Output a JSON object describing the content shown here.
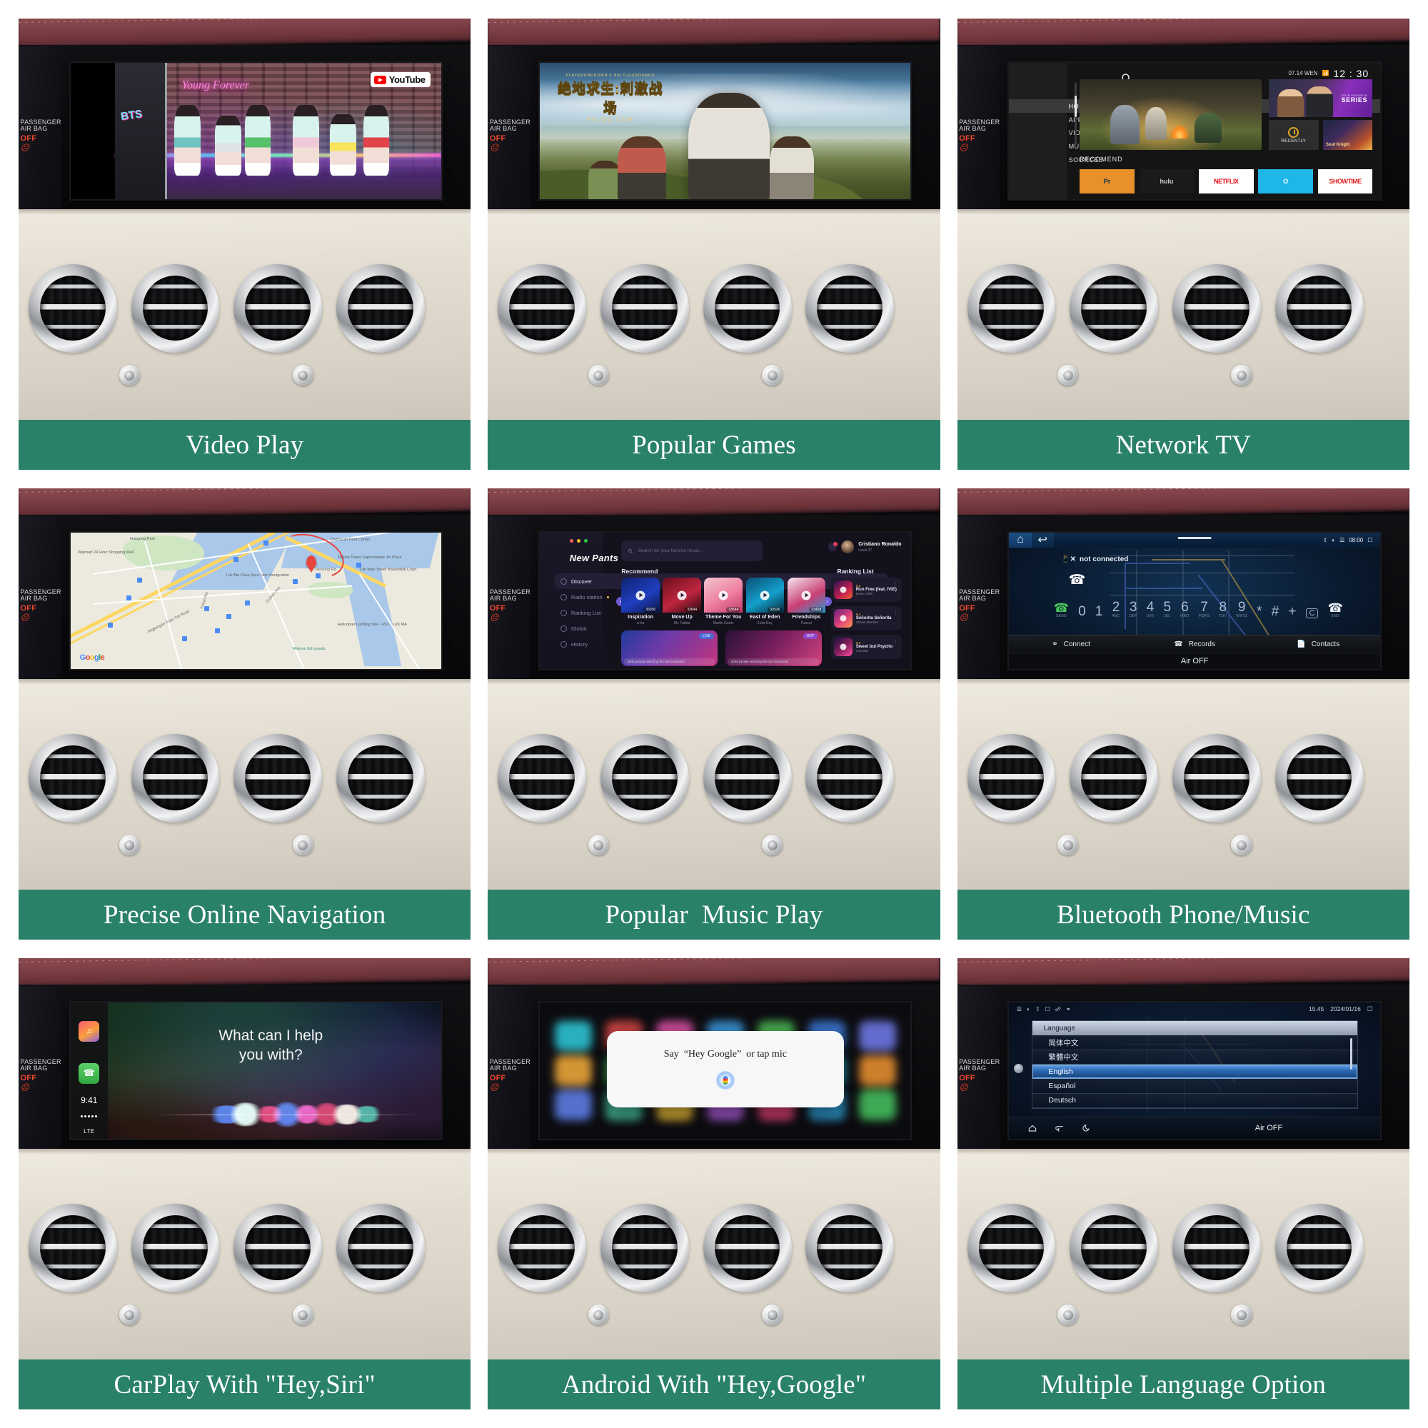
{
  "grid": {
    "accent_green": "#2a8169",
    "cells": [
      {
        "caption": "Video Play",
        "panel": "youtube"
      },
      {
        "caption": "Popular Games",
        "panel": "pubg"
      },
      {
        "caption": "Network TV",
        "panel": "networktv"
      },
      {
        "caption": "Precise Online Navigation",
        "panel": "maps"
      },
      {
        "caption": "Popular  Music Play",
        "panel": "music"
      },
      {
        "caption": "Bluetooth Phone/Music",
        "panel": "bluetooth"
      },
      {
        "caption": "CarPlay With \"Hey,Siri\"",
        "panel": "carplay"
      },
      {
        "caption": "Android With \"Hey,Google\"",
        "panel": "assistant"
      },
      {
        "caption": "Multiple Language Option",
        "panel": "language"
      }
    ]
  },
  "dashboard": {
    "airbag_line1": "PASSENGER",
    "airbag_line2": "AIR BAG",
    "airbag_status": "OFF",
    "airbag_icon": "passenger-airbag-off-icon"
  },
  "youtube": {
    "brand": "YouTube",
    "brand_icon": "youtube-play-icon",
    "neon_sign": "Young Forever",
    "wall_logo": "BTS"
  },
  "pubg": {
    "logo_top": "PLAYERUNKNOWN'S BATTLEGROUNDS",
    "logo_main": "绝地求生:刺激战场",
    "logo_sub": "PG.QQ.COM",
    "controller": "dualsense-controller"
  },
  "networktv": {
    "status": {
      "date": "07.14 WEN",
      "wifi_icon": "wifi-icon",
      "clock": "12 : 30"
    },
    "search_icon": "search-icon",
    "nav": [
      {
        "label": "HOME",
        "selected": true
      },
      {
        "label": "APPS",
        "selected": false
      },
      {
        "label": "VIDEO",
        "selected": false
      },
      {
        "label": "MUSIC",
        "selected": false
      },
      {
        "label": "SOURCES",
        "selected": false
      }
    ],
    "tiles": {
      "series_small": "YOUR FAVORITE",
      "series_big": "SERIES",
      "recently": "RECENTLY",
      "recently_icon": "history-clock-icon",
      "knight": "Soul Knight"
    },
    "section_title": "RECOMEND",
    "apps": [
      {
        "label": "Pr",
        "color": "#e8912a"
      },
      {
        "label": "hulu",
        "color": "#1a1a1a"
      },
      {
        "label": "NETFLIX",
        "color": "#ffffff"
      },
      {
        "label": "O",
        "color": "#1fb6e8"
      },
      {
        "label": "SHOWTIME",
        "color": "#ffffff"
      }
    ]
  },
  "maps": {
    "provider": "Google",
    "labels": [
      "Hungong Park",
      "Walmart 24 Hour Shopping Mall",
      "Lok Ma Chau Spur Line Immigration",
      "Chenyuan Boat Center",
      "Tiejinsi Tower Supermarket Jin Place",
      "Lok Wan Tower Basketball Court",
      "Helicopter Landing Site - FS2 - LUK MA",
      "Rileyon fish ponds",
      "Jingjiangan Expy Toll Road",
      "Futian Rd",
      "Gubian Ave",
      "Hobeing Rd"
    ],
    "pin": "destination-pin"
  },
  "music": {
    "brand": "New Pants",
    "search_placeholder": "Search for your favorite music...",
    "search_icon": "search-icon",
    "user": {
      "name": "Cristiano Ronaldo",
      "meta": "Level 27",
      "notification_count": "1"
    },
    "nav": [
      {
        "label": "Discover",
        "selected": true
      },
      {
        "label": "Radio station",
        "selected": false,
        "dot": true
      },
      {
        "label": "Ranking List",
        "selected": false
      },
      {
        "label": "Global",
        "selected": false
      },
      {
        "label": "History",
        "selected": false
      }
    ],
    "recommend_title": "Recommend",
    "recommend": [
      {
        "title": "Inspiration",
        "artist": "a-ha",
        "plays": "36936"
      },
      {
        "title": "Move Up",
        "artist": "Mr. Fabba",
        "plays": "33644"
      },
      {
        "title": "Theme For You",
        "artist": "Martin Garrix",
        "plays": "33544"
      },
      {
        "title": "East of Eden",
        "artist": "Zella Day",
        "plays": "33536"
      },
      {
        "title": "Friendships",
        "artist": "Pascal",
        "plays": "33428"
      }
    ],
    "banner_caption": "4045 people watching the live broadcast",
    "banner_badges": [
      "LIVE",
      "HOT"
    ],
    "ranking_title": "Ranking List",
    "ranking": [
      {
        "score": "9.5",
        "title": "Run Free (feat. IVIE)",
        "artist": "Deep Chills"
      },
      {
        "score": "9.4",
        "title": "Señorita Señorita",
        "artist": "Shawn Mendes"
      },
      {
        "score": "9.2",
        "title": "Sweet but Psycho",
        "artist": "Ava Max"
      }
    ]
  },
  "bluetooth": {
    "home_icon": "home-icon",
    "back_icon": "back-arrow-icon",
    "status": {
      "clock": "08:00",
      "wifi_icon": "wifi-icon",
      "signal_icon": "signal-icon",
      "bt_icon": "bluetooth-icon",
      "window_icon": "window-icon"
    },
    "not_connected": "not connected",
    "phone_icon": "phone-handset-icon",
    "keys": [
      {
        "digit": "0",
        "letters": ""
      },
      {
        "digit": "1",
        "letters": ""
      },
      {
        "digit": "2",
        "letters": "ABC"
      },
      {
        "digit": "3",
        "letters": "DEF"
      },
      {
        "digit": "4",
        "letters": "GHI"
      },
      {
        "digit": "5",
        "letters": "JKL"
      },
      {
        "digit": "6",
        "letters": "MNO"
      },
      {
        "digit": "7",
        "letters": "PQRS"
      },
      {
        "digit": "8",
        "letters": "TUV"
      },
      {
        "digit": "9",
        "letters": "WXYZ"
      },
      {
        "digit": "*",
        "letters": ""
      },
      {
        "digit": "#",
        "letters": ""
      },
      {
        "digit": "+",
        "letters": ""
      }
    ],
    "send_label": "SEND",
    "end_label": "END",
    "clear_label": "C",
    "tabs": [
      {
        "label": "Connect",
        "icon": "link-icon"
      },
      {
        "label": "Records",
        "icon": "call-log-icon"
      },
      {
        "label": "Contacts",
        "icon": "contacts-book-icon"
      }
    ],
    "air_status": "Air OFF"
  },
  "carplay": {
    "prompt_line1": "What can I help",
    "prompt_line2": "you with?",
    "clock": "9:41",
    "carrier": "LTE",
    "signal_dots": "•••••",
    "apps": [
      "music-app-icon",
      "maps-app-icon",
      "phone-app-icon"
    ],
    "home_button": "carplay-home-icon",
    "siri_waveform": "siri-waveform"
  },
  "assistant": {
    "prompt": "Say  “Hey Google”  or tap mic",
    "mic_icon": "google-assistant-mic-icon"
  },
  "language": {
    "status": {
      "clock": "15.45",
      "date": "2024/01/16"
    },
    "status_icons": [
      "signal-icon",
      "wifi-icon",
      "location-icon",
      "sim-icon",
      "bluetooth-icon",
      "link-icon",
      "window-icon"
    ],
    "panel_title": "Language",
    "options": [
      {
        "label": "简体中文",
        "selected": false
      },
      {
        "label": "繁體中文",
        "selected": false
      },
      {
        "label": "English",
        "selected": true
      },
      {
        "label": "Español",
        "selected": false
      },
      {
        "label": "Deutsch",
        "selected": false
      }
    ],
    "nav": [
      {
        "icon": "home-icon"
      },
      {
        "icon": "back-arrow-icon"
      },
      {
        "icon": "night-mode-icon"
      }
    ],
    "air_status": "Air OFF"
  }
}
